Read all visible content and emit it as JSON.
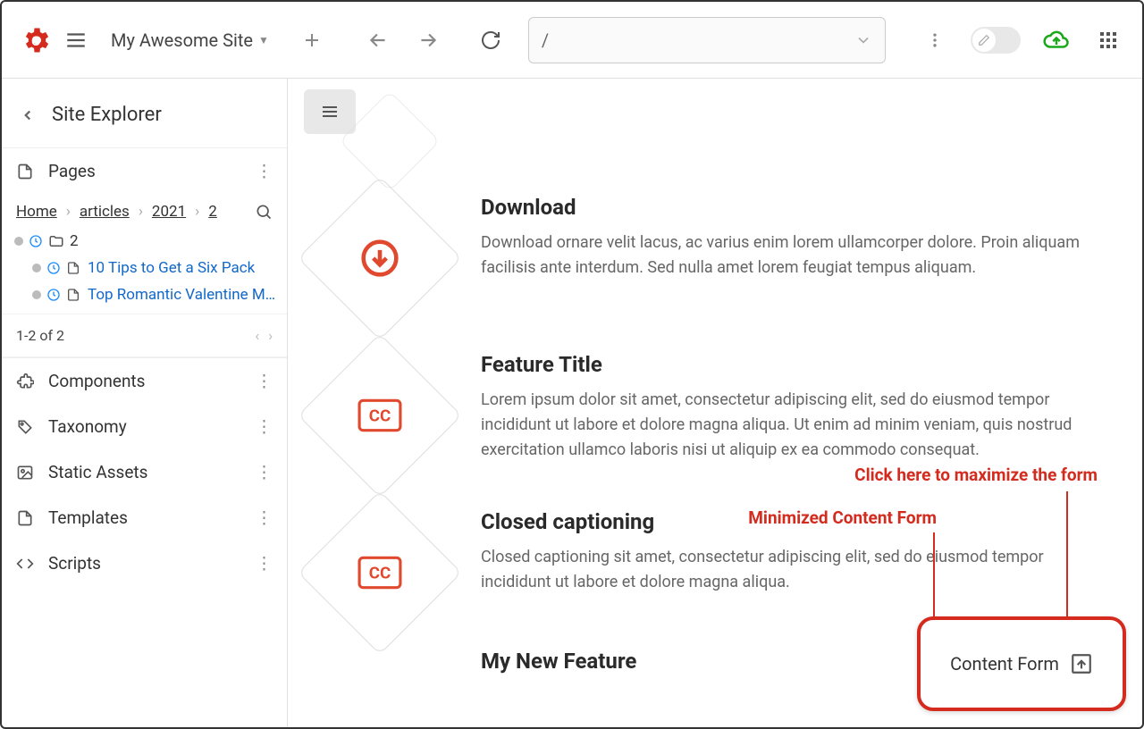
{
  "topbar": {
    "site_name": "My Awesome Site",
    "path_value": "/"
  },
  "sidebar": {
    "title": "Site Explorer",
    "pages_label": "Pages",
    "breadcrumb": [
      "Home",
      "articles",
      "2021",
      "2"
    ],
    "tree": {
      "current_folder": "2",
      "items": [
        "10 Tips to Get a Six Pack",
        "Top Romantic Valentine M…"
      ]
    },
    "pager": "1-2 of 2",
    "sections": {
      "components": "Components",
      "taxonomy": "Taxonomy",
      "static_assets": "Static Assets",
      "templates": "Templates",
      "scripts": "Scripts"
    }
  },
  "features": [
    {
      "title": "Download",
      "body": "Download ornare velit lacus, ac varius enim lorem ullamcorper dolore. Proin aliquam facilisis ante interdum. Sed nulla amet lorem feugiat tempus aliquam.",
      "icon": "download"
    },
    {
      "title": "Feature Title",
      "body": "Lorem ipsum dolor sit amet, consectetur adipiscing elit, sed do eiusmod tempor incididunt ut labore et dolore magna aliqua. Ut enim ad minim veniam, quis nostrud exercitation ullamco laboris nisi ut aliquip ex ea commodo consequat.",
      "icon": "cc"
    },
    {
      "title": "Closed captioning",
      "body": "Closed captioning sit amet, consectetur adipiscing elit, sed do eiusmod tempor incididunt ut labore et dolore magna aliqua.",
      "icon": "cc"
    },
    {
      "title": "My New Feature",
      "body": "",
      "icon": "none"
    }
  ],
  "annotations": {
    "maximize": "Click here to maximize the form",
    "minimized": "Minimized Content Form"
  },
  "content_form_label": "Content Form"
}
